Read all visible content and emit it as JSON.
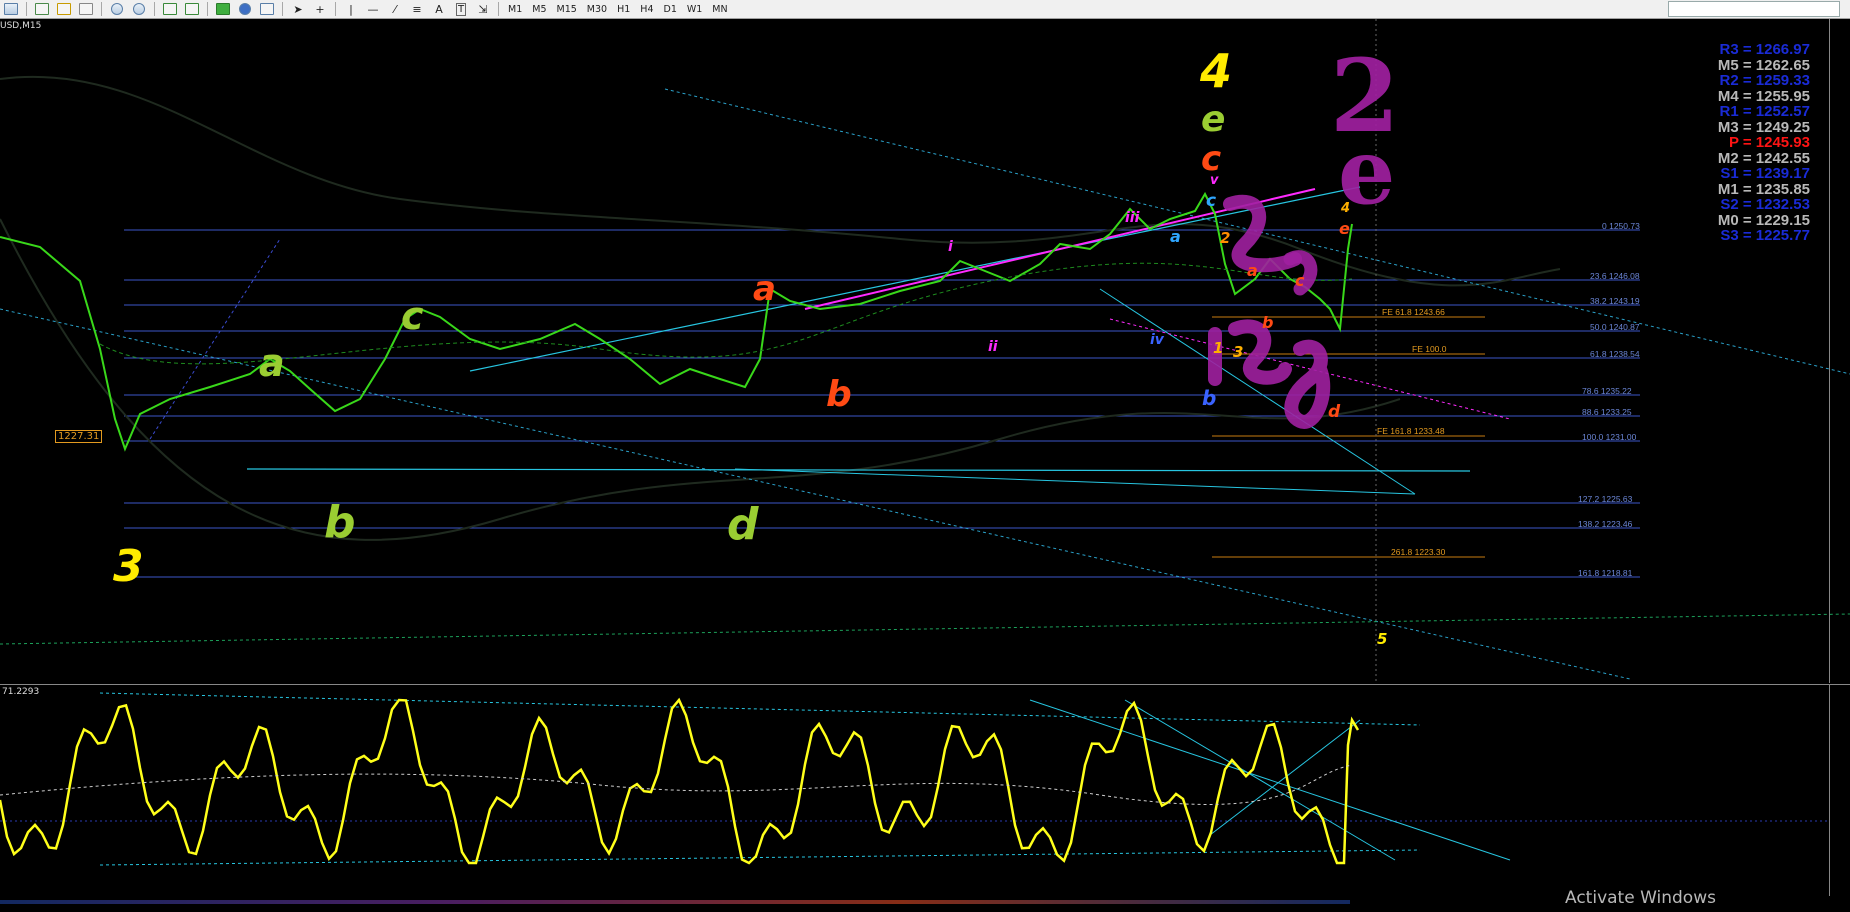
{
  "toolbar": {
    "timeframes": [
      "M1",
      "M5",
      "M15",
      "M30",
      "H1",
      "H4",
      "D1",
      "W1",
      "MN"
    ]
  },
  "chart": {
    "symbol_label": "USD,M15",
    "price_box": "1227.31",
    "indicator_label": "71.2293"
  },
  "wave_labels": {
    "w3": "3",
    "w4": "4",
    "w5": "5",
    "left_a": "a",
    "left_b": "b",
    "left_c": "c",
    "left_d": "d",
    "mid_a": "a",
    "mid_b": "b",
    "top_e": "e",
    "top_c": "c",
    "sm_i": "i",
    "sm_ii": "ii",
    "sm_iii": "iii",
    "sm_iv": "iv",
    "sm_v": "v",
    "small_c": "c",
    "small_a": "a",
    "small_b": "b",
    "small_2": "2",
    "r_a": "a",
    "r_c": "c",
    "r_b": "b",
    "r_d": "d",
    "r_e": "e",
    "r_4": "4",
    "n1": "1",
    "n3": "3",
    "blue_b": "b",
    "big_2": "2",
    "big_e": "e"
  },
  "pivots": [
    {
      "label": "R3 = 1266.97",
      "color": "#1a2bd6"
    },
    {
      "label": "M5 = 1262.65",
      "color": "#b8b8b8"
    },
    {
      "label": "R2 = 1259.33",
      "color": "#1a2bd6"
    },
    {
      "label": "M4 = 1255.95",
      "color": "#b8b8b8"
    },
    {
      "label": "R1 = 1252.57",
      "color": "#1a2bd6"
    },
    {
      "label": "M3 = 1249.25",
      "color": "#b8b8b8"
    },
    {
      "label": "P  = 1245.93",
      "color": "#ff1414"
    },
    {
      "label": "M2 = 1242.55",
      "color": "#b8b8b8"
    },
    {
      "label": "S1 = 1239.17",
      "color": "#1a2bd6"
    },
    {
      "label": "M1 = 1235.85",
      "color": "#b8b8b8"
    },
    {
      "label": "S2 = 1232.53",
      "color": "#1a2bd6"
    },
    {
      "label": "M0 = 1229.15",
      "color": "#b8b8b8"
    },
    {
      "label": "S3 = 1225.77",
      "color": "#1a2bd6"
    }
  ],
  "fib_levels": [
    "0 1250.73",
    "23.6 1246.08",
    "38.2 1243.19",
    "50.0 1240.87",
    "61.8 1238.54",
    "78.6 1235.22",
    "88.6 1233.25",
    "100.0 1231.00",
    "127.2 1225.63",
    "138.2 1223.46",
    "161.8 1218.81"
  ],
  "fe_levels": [
    "FE 61.8 1243.66",
    "FE 100.0",
    "FE 161.8 1233.48",
    "261.8 1223.30"
  ],
  "status": {
    "activate": "Activate Windows"
  }
}
